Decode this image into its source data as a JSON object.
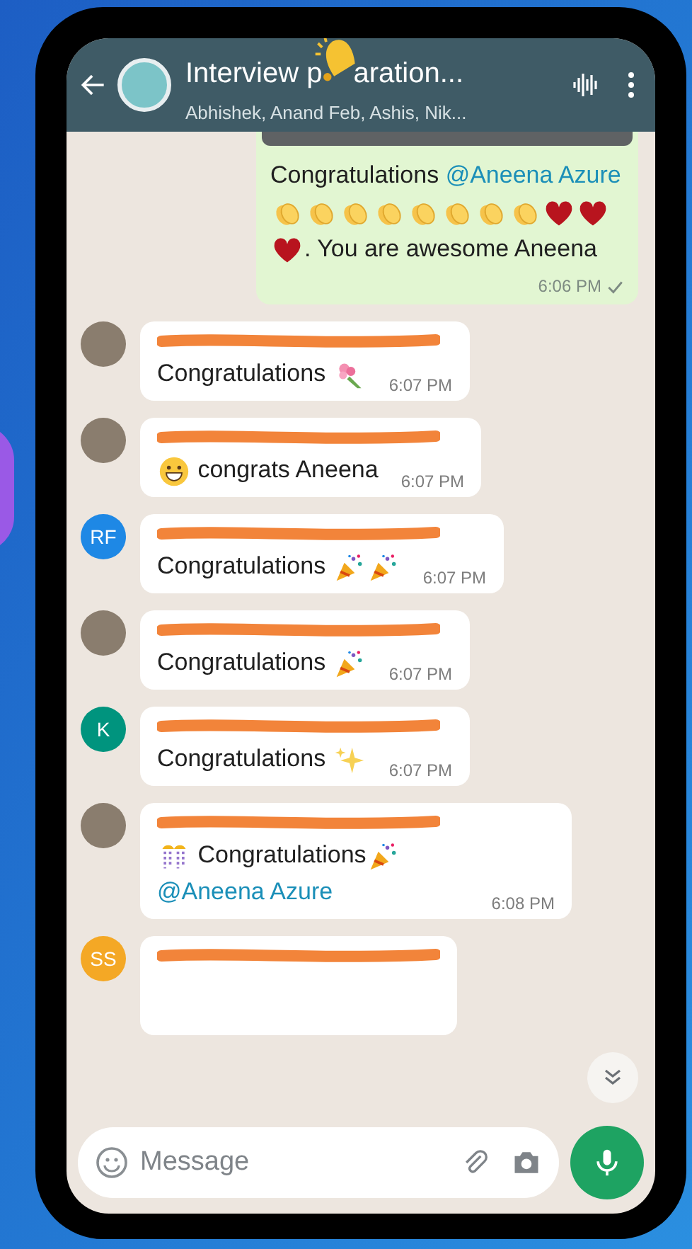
{
  "header": {
    "title_parts": [
      "Interview p",
      "aration..."
    ],
    "subtitle": "Abhishek, Anand Feb, Ashis, Nik..."
  },
  "messages": [
    {
      "kind": "outgoing",
      "has_image": true,
      "parts": [
        {
          "kind": "text",
          "text": "Congratulations "
        },
        {
          "kind": "mention",
          "text": "@Aneena Azure"
        },
        {
          "kind": "clap"
        },
        {
          "kind": "clap"
        },
        {
          "kind": "clap"
        },
        {
          "kind": "clap"
        },
        {
          "kind": "clap"
        },
        {
          "kind": "clap"
        },
        {
          "kind": "clap"
        },
        {
          "kind": "clap"
        },
        {
          "kind": "heart"
        },
        {
          "kind": "heart"
        },
        {
          "kind": "heart"
        },
        {
          "kind": "text",
          "text": ". You are awesome Aneena"
        }
      ],
      "time": "6:06 PM",
      "read": false
    },
    {
      "kind": "incoming",
      "avatar": {
        "kind": "photo"
      },
      "parts": [
        {
          "kind": "text",
          "text": "Congratulations "
        },
        {
          "kind": "bouquet"
        }
      ],
      "time": "6:07 PM"
    },
    {
      "kind": "incoming",
      "avatar": {
        "kind": "photo"
      },
      "parts": [
        {
          "kind": "grin"
        },
        {
          "kind": "text",
          "text": " congrats Aneena"
        }
      ],
      "time": "6:07 PM"
    },
    {
      "kind": "incoming",
      "avatar": {
        "kind": "initials",
        "initials": "RF",
        "color": "#1e88e5"
      },
      "parts": [
        {
          "kind": "text",
          "text": "Congratulations "
        },
        {
          "kind": "popper"
        },
        {
          "kind": "popper"
        }
      ],
      "time": "6:07 PM"
    },
    {
      "kind": "incoming",
      "avatar": {
        "kind": "photo"
      },
      "parts": [
        {
          "kind": "text",
          "text": "Congratulations "
        },
        {
          "kind": "popper"
        }
      ],
      "time": "6:07 PM"
    },
    {
      "kind": "incoming",
      "avatar": {
        "kind": "initials",
        "initials": "K",
        "color": "#00947e"
      },
      "parts": [
        {
          "kind": "text",
          "text": "Congratulations "
        },
        {
          "kind": "sparkles"
        }
      ],
      "time": "6:07 PM"
    },
    {
      "kind": "incoming",
      "avatar": {
        "kind": "photo"
      },
      "parts": [
        {
          "kind": "confetti"
        },
        {
          "kind": "text",
          "text": " Congratulations"
        },
        {
          "kind": "popper"
        },
        {
          "kind": "mention",
          "text": " @Aneena Azure"
        }
      ],
      "time": "6:08 PM"
    },
    {
      "kind": "incoming",
      "avatar": {
        "kind": "initials",
        "initials": "SS",
        "color": "#f4a825"
      }
    }
  ],
  "composer": {
    "placeholder": "Message"
  }
}
